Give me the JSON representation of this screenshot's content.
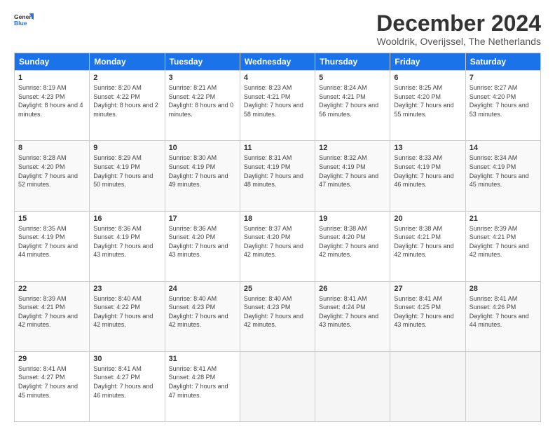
{
  "logo": {
    "general": "General",
    "blue": "Blue"
  },
  "header": {
    "month": "December 2024",
    "location": "Wooldrik, Overijssel, The Netherlands"
  },
  "weekdays": [
    "Sunday",
    "Monday",
    "Tuesday",
    "Wednesday",
    "Thursday",
    "Friday",
    "Saturday"
  ],
  "weeks": [
    [
      {
        "day": "1",
        "sunrise": "Sunrise: 8:19 AM",
        "sunset": "Sunset: 4:23 PM",
        "daylight": "Daylight: 8 hours and 4 minutes."
      },
      {
        "day": "2",
        "sunrise": "Sunrise: 8:20 AM",
        "sunset": "Sunset: 4:22 PM",
        "daylight": "Daylight: 8 hours and 2 minutes."
      },
      {
        "day": "3",
        "sunrise": "Sunrise: 8:21 AM",
        "sunset": "Sunset: 4:22 PM",
        "daylight": "Daylight: 8 hours and 0 minutes."
      },
      {
        "day": "4",
        "sunrise": "Sunrise: 8:23 AM",
        "sunset": "Sunset: 4:21 PM",
        "daylight": "Daylight: 7 hours and 58 minutes."
      },
      {
        "day": "5",
        "sunrise": "Sunrise: 8:24 AM",
        "sunset": "Sunset: 4:21 PM",
        "daylight": "Daylight: 7 hours and 56 minutes."
      },
      {
        "day": "6",
        "sunrise": "Sunrise: 8:25 AM",
        "sunset": "Sunset: 4:20 PM",
        "daylight": "Daylight: 7 hours and 55 minutes."
      },
      {
        "day": "7",
        "sunrise": "Sunrise: 8:27 AM",
        "sunset": "Sunset: 4:20 PM",
        "daylight": "Daylight: 7 hours and 53 minutes."
      }
    ],
    [
      {
        "day": "8",
        "sunrise": "Sunrise: 8:28 AM",
        "sunset": "Sunset: 4:20 PM",
        "daylight": "Daylight: 7 hours and 52 minutes."
      },
      {
        "day": "9",
        "sunrise": "Sunrise: 8:29 AM",
        "sunset": "Sunset: 4:19 PM",
        "daylight": "Daylight: 7 hours and 50 minutes."
      },
      {
        "day": "10",
        "sunrise": "Sunrise: 8:30 AM",
        "sunset": "Sunset: 4:19 PM",
        "daylight": "Daylight: 7 hours and 49 minutes."
      },
      {
        "day": "11",
        "sunrise": "Sunrise: 8:31 AM",
        "sunset": "Sunset: 4:19 PM",
        "daylight": "Daylight: 7 hours and 48 minutes."
      },
      {
        "day": "12",
        "sunrise": "Sunrise: 8:32 AM",
        "sunset": "Sunset: 4:19 PM",
        "daylight": "Daylight: 7 hours and 47 minutes."
      },
      {
        "day": "13",
        "sunrise": "Sunrise: 8:33 AM",
        "sunset": "Sunset: 4:19 PM",
        "daylight": "Daylight: 7 hours and 46 minutes."
      },
      {
        "day": "14",
        "sunrise": "Sunrise: 8:34 AM",
        "sunset": "Sunset: 4:19 PM",
        "daylight": "Daylight: 7 hours and 45 minutes."
      }
    ],
    [
      {
        "day": "15",
        "sunrise": "Sunrise: 8:35 AM",
        "sunset": "Sunset: 4:19 PM",
        "daylight": "Daylight: 7 hours and 44 minutes."
      },
      {
        "day": "16",
        "sunrise": "Sunrise: 8:36 AM",
        "sunset": "Sunset: 4:19 PM",
        "daylight": "Daylight: 7 hours and 43 minutes."
      },
      {
        "day": "17",
        "sunrise": "Sunrise: 8:36 AM",
        "sunset": "Sunset: 4:20 PM",
        "daylight": "Daylight: 7 hours and 43 minutes."
      },
      {
        "day": "18",
        "sunrise": "Sunrise: 8:37 AM",
        "sunset": "Sunset: 4:20 PM",
        "daylight": "Daylight: 7 hours and 42 minutes."
      },
      {
        "day": "19",
        "sunrise": "Sunrise: 8:38 AM",
        "sunset": "Sunset: 4:20 PM",
        "daylight": "Daylight: 7 hours and 42 minutes."
      },
      {
        "day": "20",
        "sunrise": "Sunrise: 8:38 AM",
        "sunset": "Sunset: 4:21 PM",
        "daylight": "Daylight: 7 hours and 42 minutes."
      },
      {
        "day": "21",
        "sunrise": "Sunrise: 8:39 AM",
        "sunset": "Sunset: 4:21 PM",
        "daylight": "Daylight: 7 hours and 42 minutes."
      }
    ],
    [
      {
        "day": "22",
        "sunrise": "Sunrise: 8:39 AM",
        "sunset": "Sunset: 4:21 PM",
        "daylight": "Daylight: 7 hours and 42 minutes."
      },
      {
        "day": "23",
        "sunrise": "Sunrise: 8:40 AM",
        "sunset": "Sunset: 4:22 PM",
        "daylight": "Daylight: 7 hours and 42 minutes."
      },
      {
        "day": "24",
        "sunrise": "Sunrise: 8:40 AM",
        "sunset": "Sunset: 4:23 PM",
        "daylight": "Daylight: 7 hours and 42 minutes."
      },
      {
        "day": "25",
        "sunrise": "Sunrise: 8:40 AM",
        "sunset": "Sunset: 4:23 PM",
        "daylight": "Daylight: 7 hours and 42 minutes."
      },
      {
        "day": "26",
        "sunrise": "Sunrise: 8:41 AM",
        "sunset": "Sunset: 4:24 PM",
        "daylight": "Daylight: 7 hours and 43 minutes."
      },
      {
        "day": "27",
        "sunrise": "Sunrise: 8:41 AM",
        "sunset": "Sunset: 4:25 PM",
        "daylight": "Daylight: 7 hours and 43 minutes."
      },
      {
        "day": "28",
        "sunrise": "Sunrise: 8:41 AM",
        "sunset": "Sunset: 4:26 PM",
        "daylight": "Daylight: 7 hours and 44 minutes."
      }
    ],
    [
      {
        "day": "29",
        "sunrise": "Sunrise: 8:41 AM",
        "sunset": "Sunset: 4:27 PM",
        "daylight": "Daylight: 7 hours and 45 minutes."
      },
      {
        "day": "30",
        "sunrise": "Sunrise: 8:41 AM",
        "sunset": "Sunset: 4:27 PM",
        "daylight": "Daylight: 7 hours and 46 minutes."
      },
      {
        "day": "31",
        "sunrise": "Sunrise: 8:41 AM",
        "sunset": "Sunset: 4:28 PM",
        "daylight": "Daylight: 7 hours and 47 minutes."
      },
      null,
      null,
      null,
      null
    ]
  ]
}
